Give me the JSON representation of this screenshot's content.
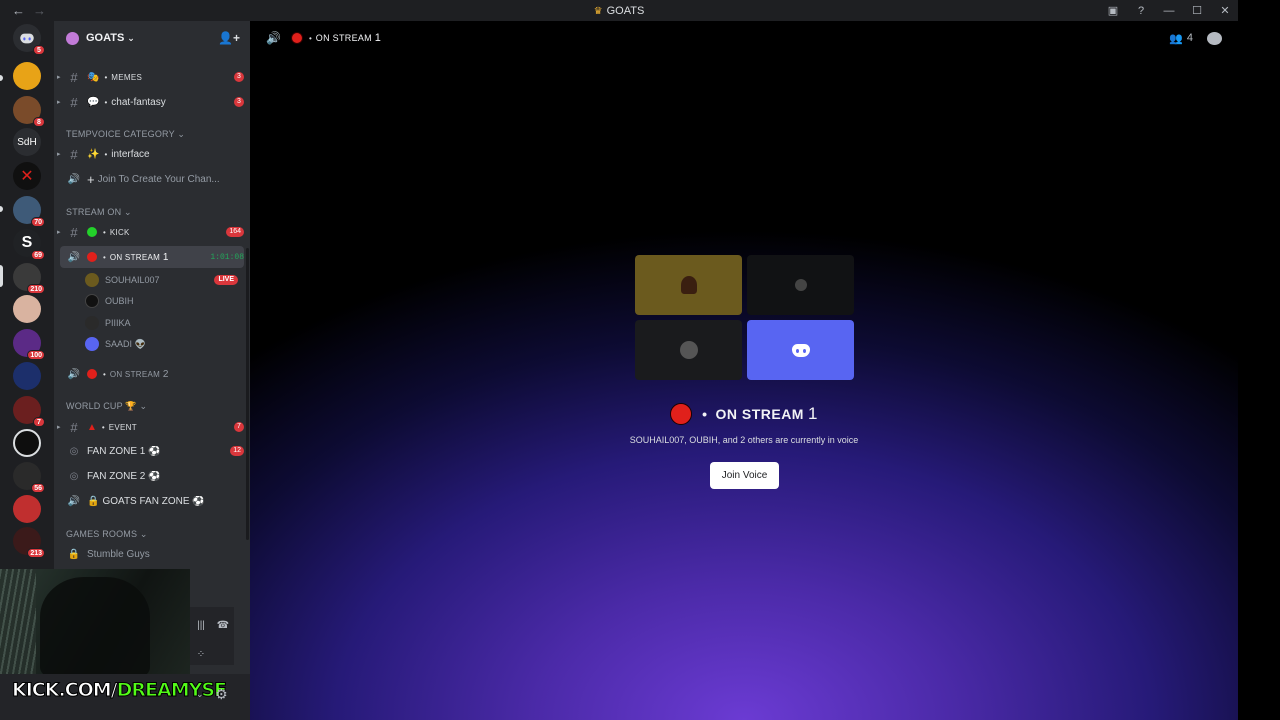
{
  "titlebar": {
    "back": "←",
    "forward": "→",
    "title": "GOATS",
    "controls": [
      "▣",
      "?",
      "—",
      "☐",
      "✕"
    ]
  },
  "rail": {
    "guilds": [
      {
        "label": "",
        "badge": "5",
        "color": "#5865f2"
      },
      {
        "label": "",
        "badge": "",
        "color": "#e8a317"
      },
      {
        "label": "",
        "badge": "8",
        "color": "#7a4b2a"
      },
      {
        "label": "SdH",
        "badge": "",
        "color": "#2b2d31"
      },
      {
        "label": "",
        "badge": "",
        "color": "#101010"
      },
      {
        "label": "",
        "badge": "70",
        "color": "#3e5a78"
      },
      {
        "label": "S",
        "badge": "69",
        "color": "#202225"
      },
      {
        "label": "",
        "badge": "210",
        "color": "#3a3a3a"
      },
      {
        "label": "",
        "badge": "",
        "color": "#d9b3a0"
      },
      {
        "label": "",
        "badge": "100",
        "color": "#5b2a86"
      },
      {
        "label": "",
        "badge": "",
        "color": "#1c2f6b"
      },
      {
        "label": "",
        "badge": "7",
        "color": "#6b1f1f"
      },
      {
        "label": "",
        "badge": "",
        "color": "#0e0e0e"
      },
      {
        "label": "",
        "badge": "56",
        "color": "#2a2a2a"
      },
      {
        "label": "",
        "badge": "",
        "color": "#c02f2f"
      },
      {
        "label": "",
        "badge": "213",
        "color": "#3b1a1a"
      }
    ]
  },
  "sidebar": {
    "server_name": "GOATS",
    "channels": {
      "memes": {
        "name": "MEMES",
        "count": "3"
      },
      "chat_fantasy": {
        "name": "chat-fantasy",
        "count": "3"
      },
      "cat_tempvoice": "TEMPVOICE CATEGORY",
      "interface": {
        "name": "interface"
      },
      "join_create": {
        "name": "Join To Create Your Chan..."
      },
      "cat_stream_on": "STREAM ON",
      "kick": {
        "name": "KICK",
        "count": "164"
      },
      "on_stream_1": {
        "name": "ON STREAM",
        "num": "1",
        "timer": "1:01:08"
      },
      "on_stream_2": {
        "name": "ON STREAM",
        "num": "2"
      },
      "cat_world_cup": "WORLD CUP 🏆",
      "event": {
        "name": "EVENT",
        "count": "7"
      },
      "fan_zone_1": {
        "name": "FAN ZONE 1 ⚽",
        "count": "12"
      },
      "fan_zone_2": {
        "name": "FAN ZONE 2 ⚽"
      },
      "goats_fan_zone": {
        "name": "GOATS FAN ZONE ⚽"
      },
      "cat_games": "GAMES ROOMS",
      "stumble": {
        "name": "Stumble Guys"
      }
    },
    "voice_users": [
      {
        "name": "SOUHAIL007",
        "live": "LIVE"
      },
      {
        "name": "OUBIH",
        "live": ""
      },
      {
        "name": "PIIIKA",
        "live": ""
      },
      {
        "name": "SAADI 👽",
        "live": ""
      }
    ],
    "overlay_text_white": "KICK.COM/",
    "overlay_text_green": "DREAMYSF"
  },
  "main": {
    "header_title": "ON STREAM",
    "header_num": "1",
    "member_count": "4",
    "stream_title": "ON STREAM",
    "stream_num": "1",
    "subtitle": "SOUHAIL007, OUBIH, and 2 others are currently in voice",
    "join_label": "Join Voice"
  }
}
